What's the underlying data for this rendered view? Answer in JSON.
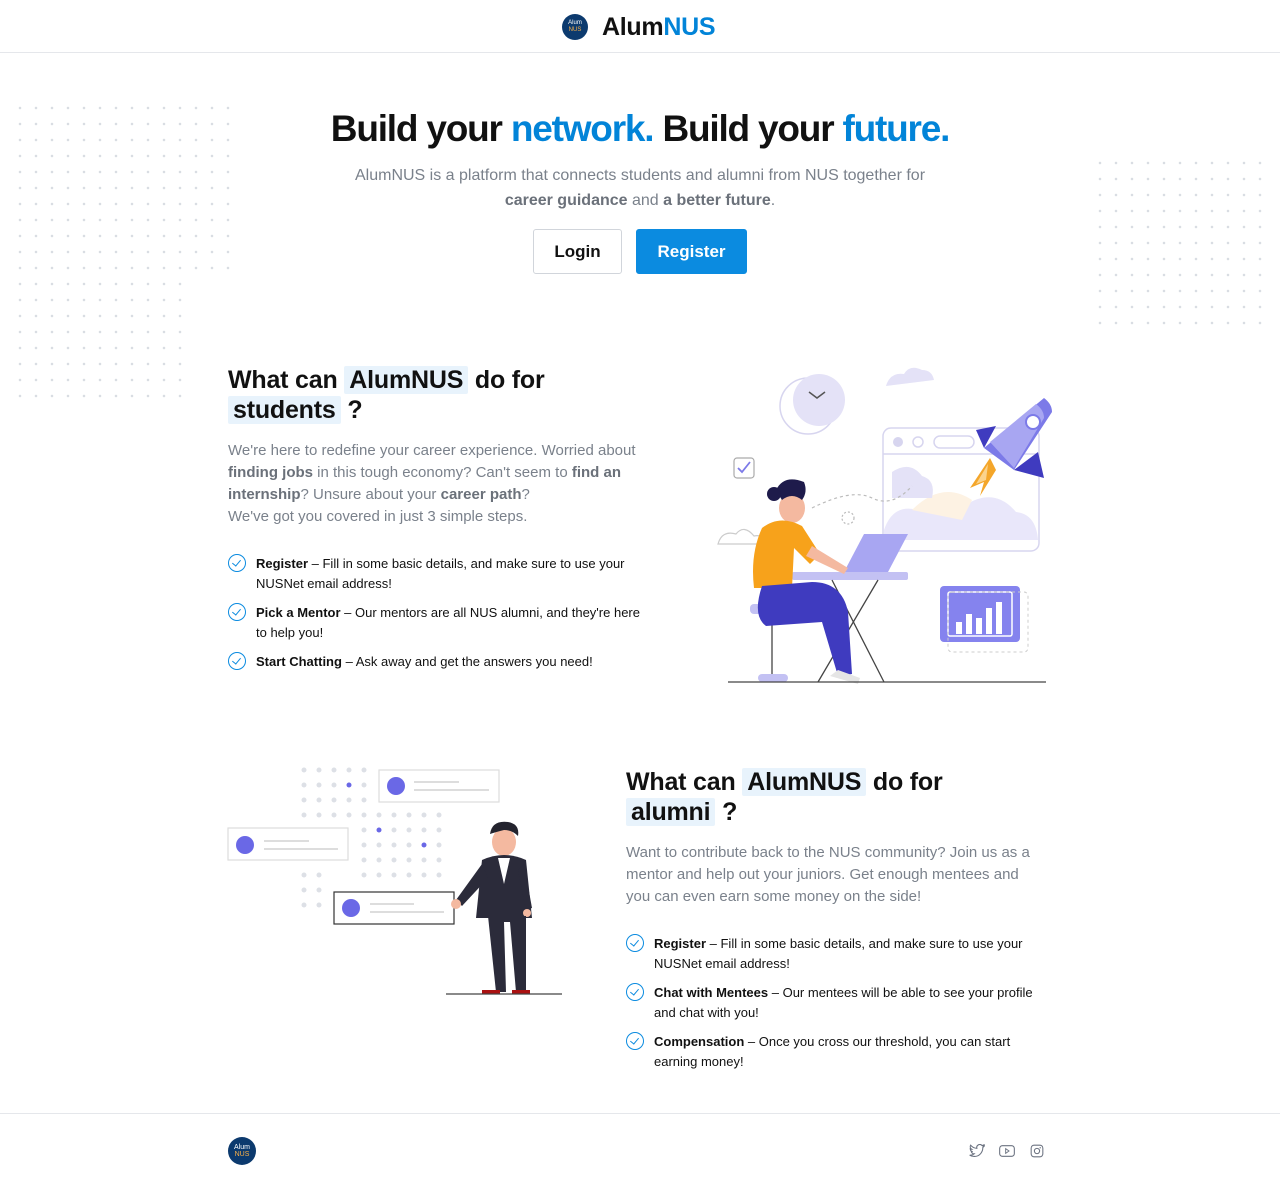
{
  "header": {
    "logo_line1": "Alum",
    "logo_line2": "NUS",
    "brand_part1": "Alum",
    "brand_part2": "NUS"
  },
  "hero": {
    "title_part1": "Build your ",
    "title_highlight1": "network.",
    "title_part2": " Build your ",
    "title_highlight2": "future.",
    "subtitle_part1": "AlumNUS is a platform that connects students and alumni from NUS together for ",
    "subtitle_bold1": "career guidance",
    "subtitle_part2": " and ",
    "subtitle_bold2": "a better future",
    "subtitle_part3": ".",
    "login_label": "Login",
    "register_label": "Register"
  },
  "students": {
    "title_prefix": "What can ",
    "title_highlight": "AlumNUS",
    "title_middle": " do for",
    "title_target": "students",
    "title_suffix": " ?",
    "desc_1": "We're here to redefine your career experience. Worried about ",
    "desc_b1": "finding jobs",
    "desc_2": " in this tough economy? Can't seem to ",
    "desc_b2": "find an internship",
    "desc_3": "? Unsure about your ",
    "desc_b3": "career path",
    "desc_4": "?",
    "desc_5": "We've got you covered in just 3 simple steps.",
    "steps": [
      {
        "title": "Register",
        "text": " – Fill in some basic details, and make sure to use your NUSNet email address!"
      },
      {
        "title": "Pick a Mentor",
        "text": " – Our mentors are all NUS alumni, and they're here to help you!"
      },
      {
        "title": "Start Chatting",
        "text": " – Ask away and get the answers you need!"
      }
    ]
  },
  "alumni": {
    "title_prefix": "What can ",
    "title_highlight": "AlumNUS",
    "title_middle": " do for",
    "title_target": "alumni",
    "title_suffix": " ?",
    "desc": "Want to contribute back to the NUS community? Join us as a mentor and help out your juniors. Get enough mentees and you can even earn some money on the side!",
    "steps": [
      {
        "title": "Register",
        "text": " – Fill in some basic details, and make sure to use your NUSNet email address!"
      },
      {
        "title": "Chat with Mentees",
        "text": " – Our mentees will be able to see your profile and chat with you!"
      },
      {
        "title": "Compensation",
        "text": " – Once you cross our threshold, you can start earning money!"
      }
    ]
  },
  "footer": {
    "logo_line1": "Alum",
    "logo_line2": "NUS",
    "social": [
      "twitter-icon",
      "youtube-icon",
      "instagram-icon"
    ]
  },
  "colors": {
    "accent": "#0b8be0",
    "brand_blue": "#0284d8",
    "highlight_bg": "#e8f3fc",
    "logo_navy": "#0c3a6e"
  }
}
